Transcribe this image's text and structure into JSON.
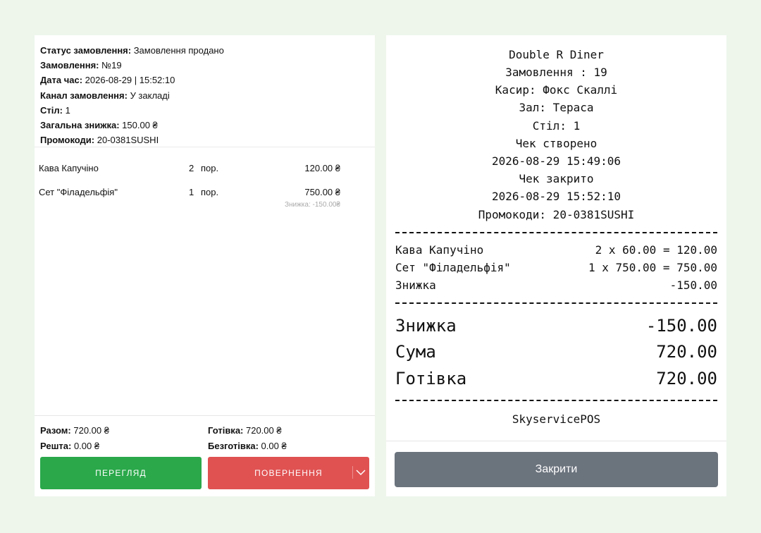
{
  "order": {
    "status_label": "Статус замовлення:",
    "status_value": " Замовлення продано",
    "number_label": "Замовлення:",
    "number_value": " №19",
    "datetime_label": "Дата час:",
    "datetime_value": " 2026-08-29 | 15:52:10",
    "channel_label": "Канал замовлення:",
    "channel_value": " У закладі",
    "table_label": "Стіл:",
    "table_value": " 1",
    "discount_label": "Загальна знижка:",
    "discount_value": " 150.00 ₴",
    "promo_label": "Промокоди:",
    "promo_value": " 20-0381SUSHI"
  },
  "items": [
    {
      "name": "Кава Капучіно",
      "qty": "2",
      "unit": "пор.",
      "price": "120.00 ₴",
      "discount": ""
    },
    {
      "name": "Сет \"Філадельфія\"",
      "qty": "1",
      "unit": "пор.",
      "price": "750.00 ₴",
      "discount": "Знижка: -150.00₴"
    }
  ],
  "totals": {
    "sum_label": "Разом:",
    "sum_value": " 720.00 ₴",
    "change_label": "Решта:",
    "change_value": " 0.00 ₴",
    "cash_label": "Готівка:",
    "cash_value": " 720.00 ₴",
    "noncash_label": "Безготівка:",
    "noncash_value": " 0.00 ₴"
  },
  "buttons": {
    "view": "ПЕРЕГЛЯД",
    "return": "ПОВЕРНЕННЯ",
    "return_menu_icon": "chevron-down-icon",
    "close": "Закрити"
  },
  "receipt": {
    "header": [
      "Double R Diner",
      "Замовлення : 19",
      "Касир: Фокс Скаллі",
      "Зал: Тераса",
      "Стіл: 1",
      "Чек створено",
      "2026-08-29 15:49:06",
      "Чек закрито",
      "2026-08-29 15:52:10",
      "Промокоди: 20-0381SUSHI"
    ],
    "lines": [
      {
        "left": "Кава Капучіно",
        "right": "2 x 60.00 = 120.00"
      },
      {
        "left": "Сет \"Філадельфія\"",
        "right": "1 x 750.00 = 750.00"
      },
      {
        "left": "Знижка",
        "right": "-150.00"
      }
    ],
    "totals": [
      {
        "left": "Знижка",
        "right": "-150.00"
      },
      {
        "left": "Сума",
        "right": "720.00"
      },
      {
        "left": "Готівка",
        "right": "720.00"
      }
    ],
    "footer": "SkyservicePOS"
  },
  "colors": {
    "background": "#eef6ec",
    "view_button": "#2aa84a",
    "return_button": "#e05252",
    "close_button": "#6b737d"
  }
}
